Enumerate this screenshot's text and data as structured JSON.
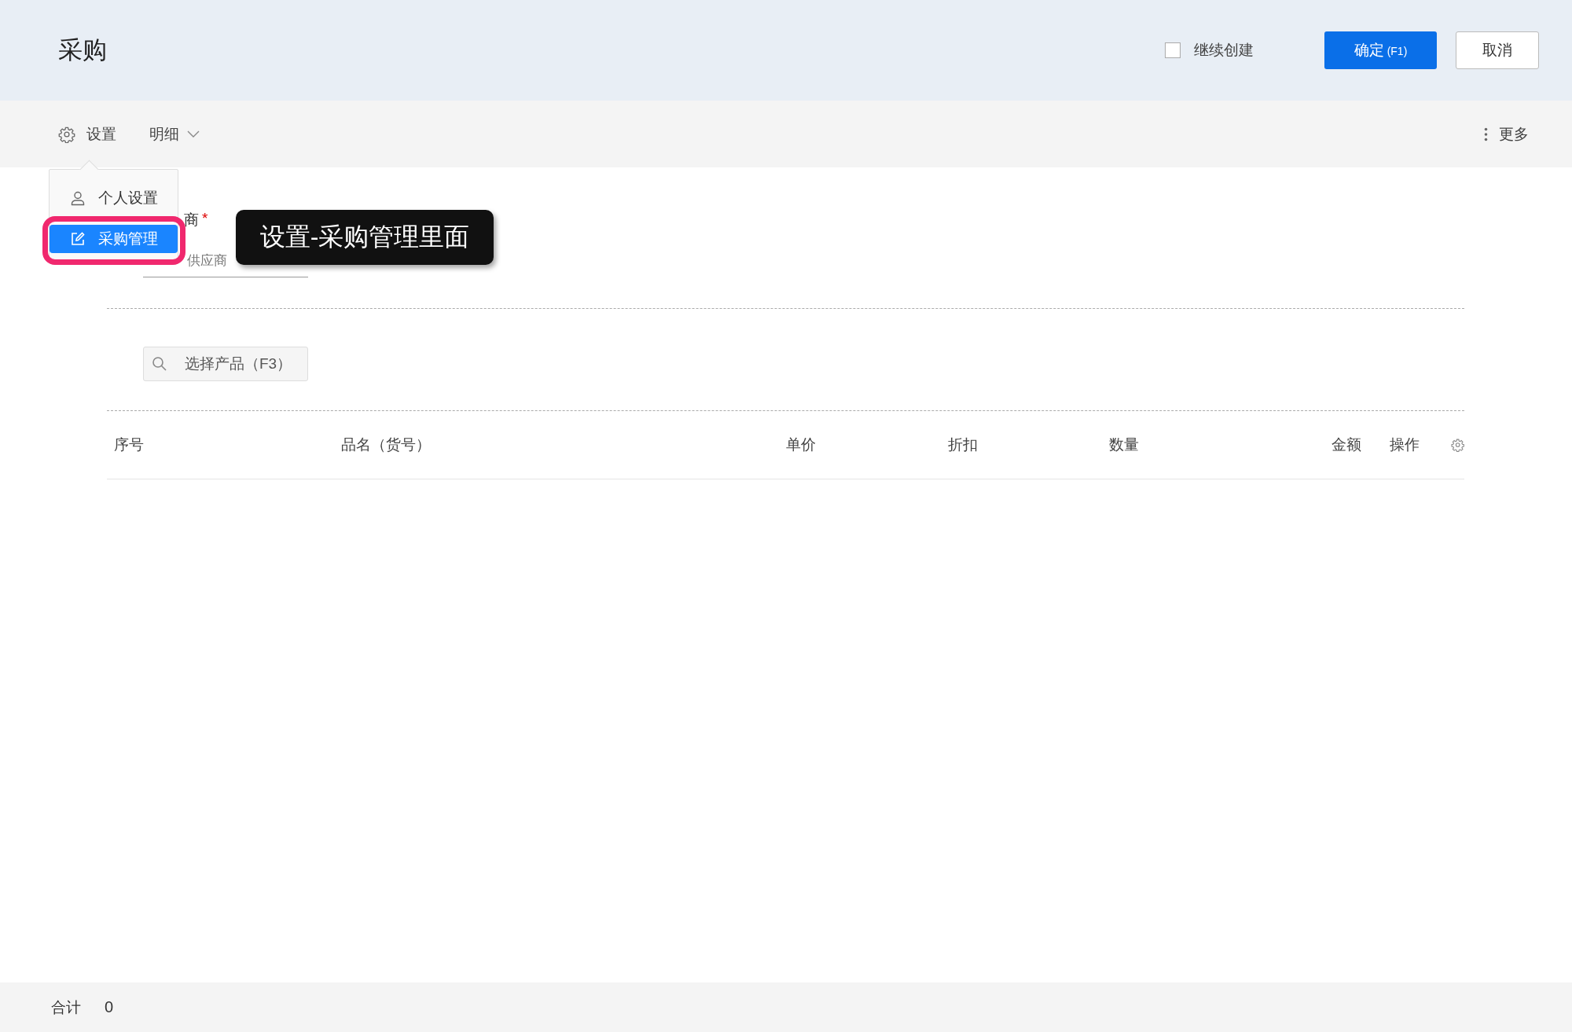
{
  "header": {
    "title": "采购",
    "continue_create": {
      "label": "继续创建",
      "checked": false
    },
    "buttons": [
      {
        "kind": "primary",
        "label": "确定",
        "shortcut": "(F1)"
      },
      {
        "kind": "default",
        "label": "取消"
      }
    ]
  },
  "toolbar": {
    "settings": "设置",
    "detail": "明细",
    "more": "更多"
  },
  "settings_menu": {
    "items": [
      {
        "label": "个人设置",
        "kind": "person",
        "selected": false
      },
      {
        "label": "采购管理",
        "kind": "edit",
        "selected": true
      }
    ]
  },
  "annotation": {
    "text": "设置-采购管理里面"
  },
  "supplier": {
    "label": "商",
    "required_mark": "*",
    "placeholder": "供应商"
  },
  "product_search": {
    "placeholder": "选择产品（F3）"
  },
  "table": {
    "columns": [
      {
        "label": "序号"
      },
      {
        "label": "品名（货号）"
      },
      {
        "label": "单价"
      },
      {
        "label": "折扣"
      },
      {
        "label": "数量"
      },
      {
        "label": "金额"
      },
      {
        "label": "操作"
      }
    ]
  },
  "footer": {
    "label": "合计",
    "value": "0"
  }
}
